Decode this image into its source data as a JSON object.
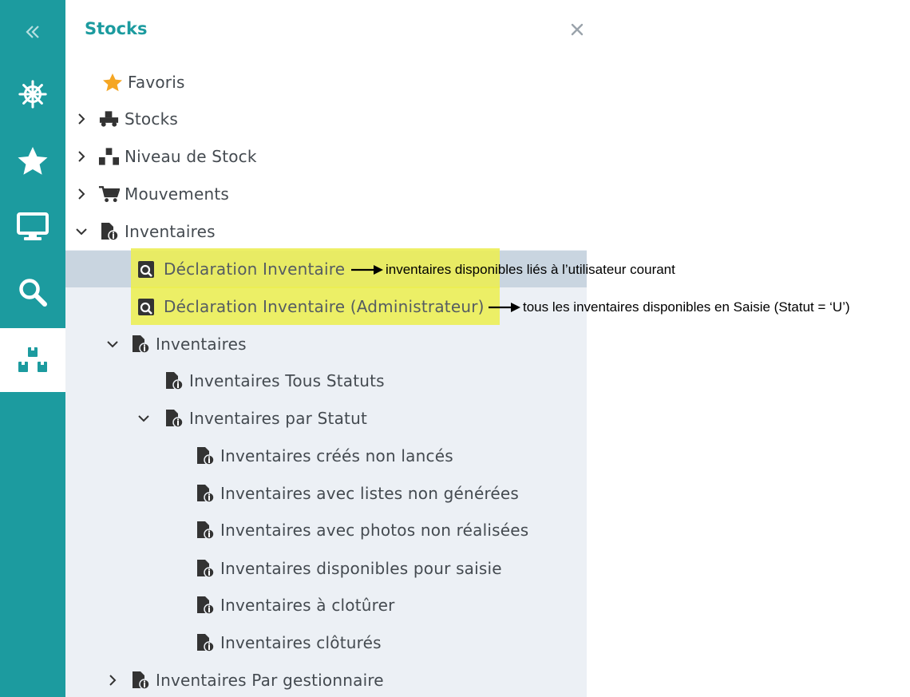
{
  "rail": {
    "items": [
      {
        "icon": "double-chevron-left-icon"
      },
      {
        "icon": "ship-wheel-icon"
      },
      {
        "icon": "star-icon"
      },
      {
        "icon": "monitor-icon"
      },
      {
        "icon": "search-icon"
      },
      {
        "icon": "boxes-icon",
        "active": true
      }
    ]
  },
  "panel": {
    "title": "Stocks",
    "close_icon": "close-icon"
  },
  "tree": {
    "favoris": "Favoris",
    "stocks": "Stocks",
    "niveau_stock": "Niveau de Stock",
    "mouvements": "Mouvements",
    "inventaires_root": "Inventaires",
    "declaration": "Déclaration Inventaire",
    "declaration_admin": "Déclaration Inventaire (Administrateur)",
    "inventaires_sub": "Inventaires",
    "tous_statuts": "Inventaires Tous Statuts",
    "par_statut": "Inventaires par Statut",
    "statuts": [
      "Inventaires créés non lancés",
      "Inventaires avec listes non générées",
      "Inventaires avec photos non réalisées",
      "Inventaires disponibles pour saisie",
      "Inventaires à clotûrer",
      "Inventaires clôturés"
    ],
    "par_gestionnaire": "Inventaires Par gestionnaire"
  },
  "annotations": {
    "declaration": "inventaires disponibles liés à l’utilisateur courant",
    "declaration_admin": "tous les inventaires disponibles en Saisie (Statut = ‘U’)"
  },
  "colors": {
    "teal": "#1c9b9f",
    "highlight": "#ecee52",
    "selected_row": "#c9d5e0",
    "tree_bg": "#ecf0f5",
    "star": "#f5a623"
  }
}
